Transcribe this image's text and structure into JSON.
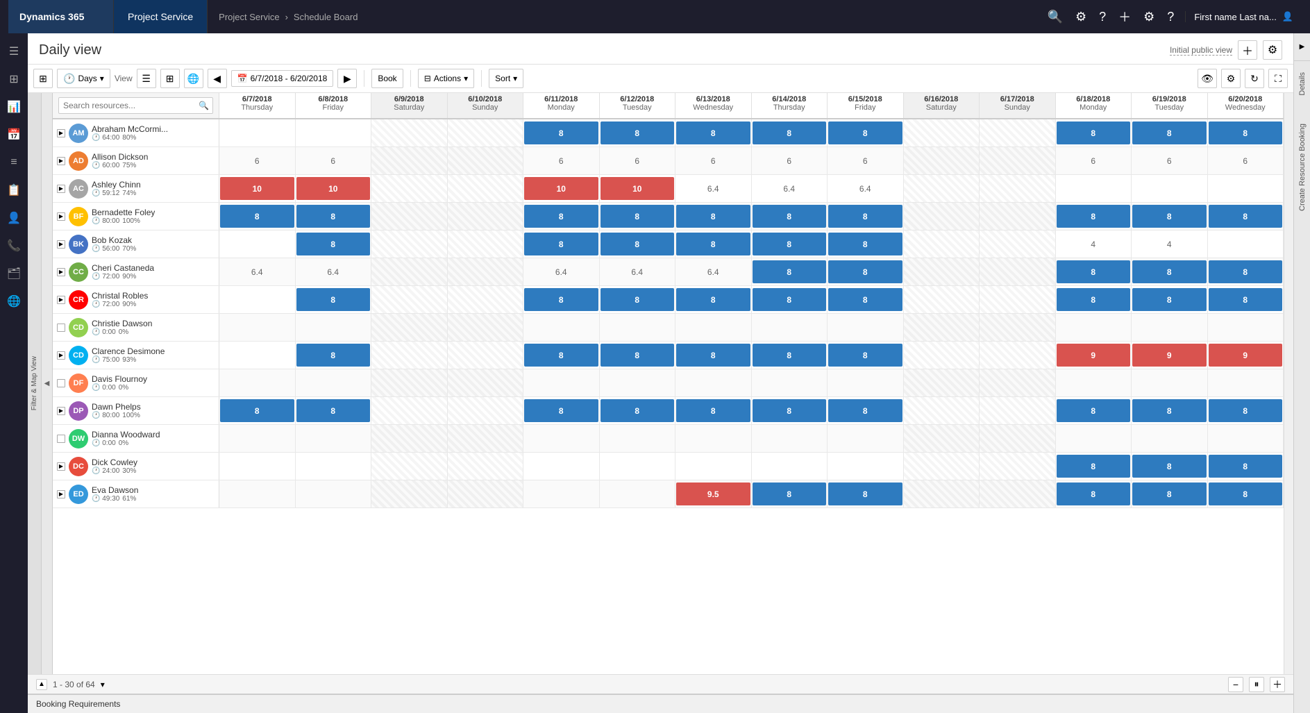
{
  "topNav": {
    "brand": "Dynamics 365",
    "module": "Project Service",
    "breadcrumb1": "Project Service",
    "breadcrumb2": "Schedule Board",
    "user": "First name Last na..."
  },
  "pageHeader": {
    "title": "Daily view",
    "initialViewLabel": "Initial public view"
  },
  "toolbar": {
    "daysLabel": "Days",
    "viewLabel": "View",
    "dateRange": "6/7/2018 - 6/20/2018",
    "bookLabel": "Book",
    "actionsLabel": "Actions",
    "sortLabel": "Sort"
  },
  "search": {
    "placeholder": "Search resources..."
  },
  "dates": [
    {
      "date": "6/7/2018",
      "day": "Thursday",
      "weekend": false
    },
    {
      "date": "6/8/2018",
      "day": "Friday",
      "weekend": false
    },
    {
      "date": "6/9/2018",
      "day": "Saturday",
      "weekend": true
    },
    {
      "date": "6/10/2018",
      "day": "Sunday",
      "weekend": true
    },
    {
      "date": "6/11/2018",
      "day": "Monday",
      "weekend": false
    },
    {
      "date": "6/12/2018",
      "day": "Tuesday",
      "weekend": false
    },
    {
      "date": "6/13/2018",
      "day": "Wednesday",
      "weekend": false
    },
    {
      "date": "6/14/2018",
      "day": "Thursday",
      "weekend": false
    },
    {
      "date": "6/15/2018",
      "day": "Friday",
      "weekend": false
    },
    {
      "date": "6/16/2018",
      "day": "Saturday",
      "weekend": true
    },
    {
      "date": "6/17/2018",
      "day": "Sunday",
      "weekend": true
    },
    {
      "date": "6/18/2018",
      "day": "Monday",
      "weekend": false
    },
    {
      "date": "6/19/2018",
      "day": "Tuesday",
      "weekend": false
    },
    {
      "date": "6/20/2018",
      "day": "Wednesday",
      "weekend": false
    }
  ],
  "resources": [
    {
      "name": "Abraham McCormi...",
      "hours": "64:00",
      "util": "80%",
      "initials": "AM",
      "cells": [
        null,
        null,
        null,
        null,
        "8b",
        "8b",
        "8b",
        "8b",
        "8b",
        null,
        null,
        "8b",
        "8b",
        "8b"
      ]
    },
    {
      "name": "Allison Dickson",
      "hours": "60:00",
      "util": "75%",
      "initials": "AD",
      "cells": [
        "6",
        "6",
        null,
        null,
        "6",
        "6",
        "6",
        "6",
        "6",
        null,
        null,
        "6",
        "6",
        "6"
      ]
    },
    {
      "name": "Ashley Chinn",
      "hours": "59:12",
      "util": "74%",
      "initials": "AC",
      "cells": [
        "10r",
        "10r",
        null,
        null,
        "10r",
        "10r",
        "6.4",
        "6.4",
        "6.4",
        null,
        null,
        null,
        null,
        null
      ]
    },
    {
      "name": "Bernadette Foley",
      "hours": "80:00",
      "util": "100%",
      "initials": "BF",
      "cells": [
        "8b",
        "8b",
        null,
        null,
        "8b",
        "8b",
        "8b",
        "8b",
        "8b",
        null,
        null,
        "8b",
        "8b",
        "8b"
      ]
    },
    {
      "name": "Bob Kozak",
      "hours": "56:00",
      "util": "70%",
      "initials": "BK",
      "cells": [
        null,
        "8b",
        null,
        null,
        "8b",
        "8b",
        "8b",
        "8b",
        "8b",
        null,
        null,
        "4",
        "4",
        null
      ]
    },
    {
      "name": "Cheri Castaneda",
      "hours": "72:00",
      "util": "90%",
      "initials": "CC",
      "cells": [
        "6.4",
        "6.4",
        null,
        null,
        "6.4",
        "6.4",
        "6.4",
        "8b",
        "8b",
        null,
        null,
        "8b",
        "8b",
        "8b"
      ]
    },
    {
      "name": "Christal Robles",
      "hours": "72:00",
      "util": "90%",
      "initials": "CR",
      "cells": [
        null,
        "8b",
        null,
        null,
        "8b",
        "8b",
        "8b",
        "8b",
        "8b",
        null,
        null,
        "8b",
        "8b",
        "8b"
      ]
    },
    {
      "name": "Christie Dawson",
      "hours": "0:00",
      "util": "0%",
      "initials": "CD",
      "cells": [
        null,
        null,
        null,
        null,
        null,
        null,
        null,
        null,
        null,
        null,
        null,
        null,
        null,
        null
      ]
    },
    {
      "name": "Clarence Desimone",
      "hours": "75:00",
      "util": "93%",
      "initials": "CD",
      "cells": [
        null,
        "8b",
        null,
        null,
        "8b",
        "8b",
        "8b",
        "8b",
        "8b",
        null,
        null,
        "9r",
        "9r",
        "9r"
      ]
    },
    {
      "name": "Davis Flournoy",
      "hours": "0:00",
      "util": "0%",
      "initials": "DF",
      "cells": [
        null,
        null,
        null,
        null,
        null,
        null,
        null,
        null,
        null,
        null,
        null,
        null,
        null,
        null
      ]
    },
    {
      "name": "Dawn Phelps",
      "hours": "80:00",
      "util": "100%",
      "initials": "DP",
      "cells": [
        "8b",
        "8b",
        null,
        null,
        "8b",
        "8b",
        "8b",
        "8b",
        "8b",
        null,
        null,
        "8b",
        "8b",
        "8b"
      ]
    },
    {
      "name": "Dianna Woodward",
      "hours": "0:00",
      "util": "0%",
      "initials": "DW",
      "cells": [
        null,
        null,
        null,
        null,
        null,
        null,
        null,
        null,
        null,
        null,
        null,
        null,
        null,
        null
      ]
    },
    {
      "name": "Dick Cowley",
      "hours": "24:00",
      "util": "30%",
      "initials": "DC",
      "cells": [
        null,
        null,
        null,
        null,
        null,
        null,
        null,
        null,
        null,
        null,
        null,
        "8b",
        "8b",
        "8b"
      ]
    },
    {
      "name": "Eva Dawson",
      "hours": "49:30",
      "util": "61%",
      "initials": "ED",
      "cells": [
        null,
        null,
        null,
        null,
        null,
        null,
        "9.5r",
        "8b",
        "8b",
        null,
        null,
        "8b",
        "8b",
        "8b"
      ]
    }
  ],
  "pagination": {
    "label": "1 - 30 of 64"
  },
  "bookingRequirements": {
    "label": "Booking Requirements"
  },
  "rightSidebar": {
    "details": "Details",
    "createBooking": "Create Resource Booking"
  }
}
